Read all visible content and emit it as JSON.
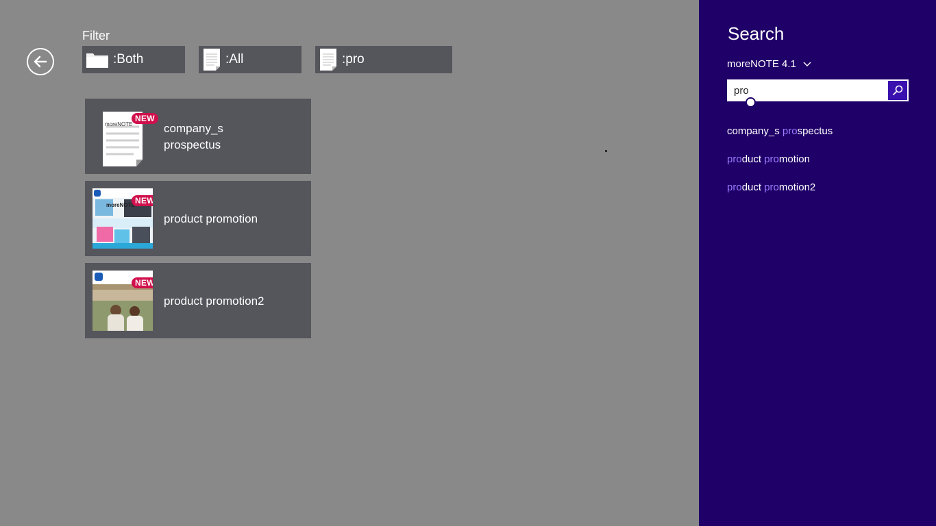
{
  "filter": {
    "label": "Filter",
    "buttons": [
      {
        "label": ":Both",
        "icon": "folder-icon"
      },
      {
        "label": ":All",
        "icon": "document-icon"
      },
      {
        "label": ":pro",
        "icon": "document-icon"
      }
    ]
  },
  "results": [
    {
      "title_line1": "company_s",
      "title_line2": "prospectus",
      "badge": "NEW",
      "thumb_text": "moreNOTE"
    },
    {
      "title": "product promotion",
      "badge": "NEW",
      "thumb_text": "moreNOTE"
    },
    {
      "title": "product promotion2",
      "badge": "NEW"
    }
  ],
  "search_pane": {
    "title": "Search",
    "scope": "moreNOTE 4.1",
    "query": "pro",
    "suggestions": [
      {
        "parts": [
          "company_s ",
          "pro",
          "spectus"
        ]
      },
      {
        "parts": [
          "",
          "pro",
          "duct ",
          "pro",
          "motion"
        ]
      },
      {
        "parts": [
          "",
          "pro",
          "duct ",
          "pro",
          "motion2"
        ]
      }
    ]
  },
  "colors": {
    "background": "#898989",
    "tile": "#55555c",
    "pane": "#1f0068",
    "highlight": "#9b7bff",
    "badge": "#d0104c",
    "search_button": "#3a11ae"
  }
}
